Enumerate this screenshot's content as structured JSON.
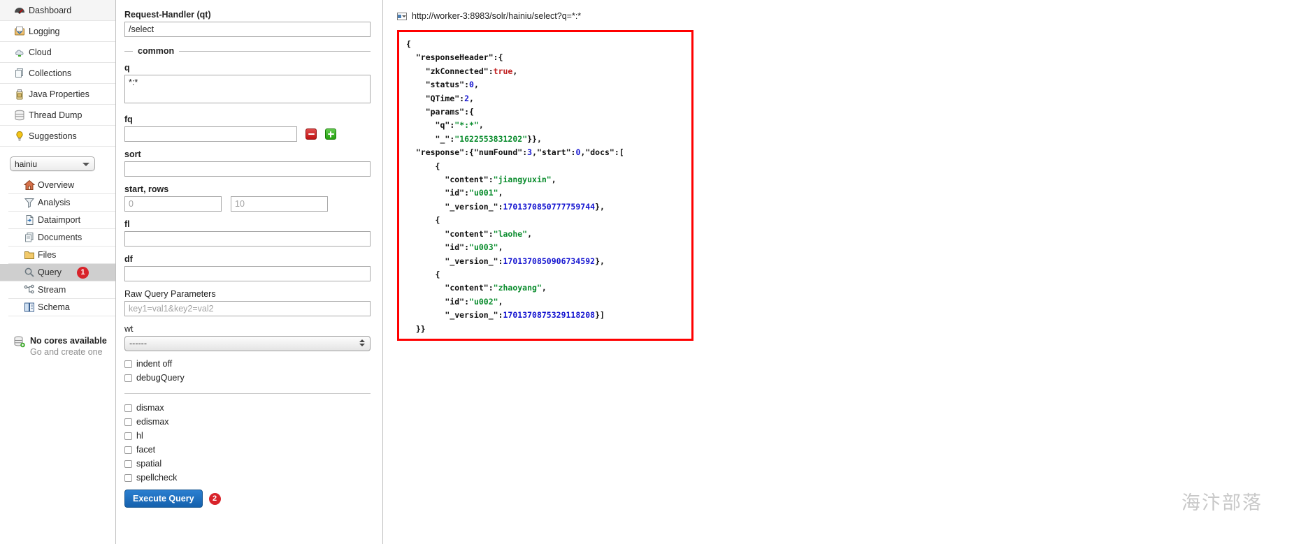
{
  "sidebar": {
    "main_items": [
      {
        "label": "Dashboard",
        "icon": "dashboard-icon"
      },
      {
        "label": "Logging",
        "icon": "logging-icon"
      },
      {
        "label": "Cloud",
        "icon": "cloud-icon"
      },
      {
        "label": "Collections",
        "icon": "collections-icon"
      },
      {
        "label": "Java Properties",
        "icon": "java-properties-icon"
      },
      {
        "label": "Thread Dump",
        "icon": "thread-dump-icon"
      },
      {
        "label": "Suggestions",
        "icon": "suggestions-icon"
      }
    ],
    "core_selector": {
      "value": "hainiu",
      "icon": "chevron-down-icon"
    },
    "core_items": [
      {
        "label": "Overview",
        "icon": "overview-home-icon",
        "active": false
      },
      {
        "label": "Analysis",
        "icon": "analysis-funnel-icon",
        "active": false
      },
      {
        "label": "Dataimport",
        "icon": "dataimport-icon",
        "active": false
      },
      {
        "label": "Documents",
        "icon": "documents-icon",
        "active": false
      },
      {
        "label": "Files",
        "icon": "files-folder-icon",
        "active": false
      },
      {
        "label": "Query",
        "icon": "query-magnifier-icon",
        "active": true,
        "badge": "1"
      },
      {
        "label": "Stream",
        "icon": "stream-graph-icon",
        "active": false
      },
      {
        "label": "Schema",
        "icon": "schema-book-icon",
        "active": false
      }
    ],
    "no_cores": {
      "title": "No cores available",
      "subtitle": "Go and create one",
      "icon": "core-add-icon"
    }
  },
  "query_form": {
    "request_handler": {
      "label": "Request-Handler (qt)",
      "value": "/select"
    },
    "common_legend": "common",
    "q": {
      "label": "q",
      "value": "*:*"
    },
    "fq": {
      "label": "fq",
      "value": "",
      "remove_icon": "minus-icon",
      "add_icon": "plus-icon"
    },
    "sort": {
      "label": "sort",
      "value": ""
    },
    "start_rows": {
      "label": "start, rows",
      "start_placeholder": "0",
      "rows_placeholder": "10",
      "start_value": "",
      "rows_value": ""
    },
    "fl": {
      "label": "fl",
      "value": ""
    },
    "df": {
      "label": "df",
      "value": ""
    },
    "raw_query_parameters": {
      "label": "Raw Query Parameters",
      "placeholder": "key1=val1&key2=val2",
      "value": ""
    },
    "wt": {
      "label": "wt",
      "selected": "------",
      "icon": "updown-arrows-icon"
    },
    "toggles_top": [
      {
        "label": "indent off",
        "checked": false
      },
      {
        "label": "debugQuery",
        "checked": false
      }
    ],
    "toggles_bottom": [
      {
        "label": "dismax",
        "checked": false
      },
      {
        "label": "edismax",
        "checked": false
      },
      {
        "label": "hl",
        "checked": false
      },
      {
        "label": "facet",
        "checked": false
      },
      {
        "label": "spatial",
        "checked": false
      },
      {
        "label": "spellcheck",
        "checked": false
      }
    ],
    "execute": {
      "label": "Execute Query",
      "badge": "2"
    }
  },
  "result": {
    "url": "http://worker-3:8983/solr/hainiu/select?q=*:*",
    "url_icon": "external-window-icon",
    "border_color": "#ff0000",
    "response_json": {
      "responseHeader": {
        "zkConnected": "true",
        "status": "0",
        "QTime": "2",
        "params": {
          "q": "*:*",
          "_": "1622553831202"
        }
      },
      "response": {
        "numFound": "3",
        "start": "0",
        "docs": [
          {
            "content": "jiangyuxin",
            "id": "u001",
            "_version_": "1701370850777759744"
          },
          {
            "content": "laohe",
            "id": "u003",
            "_version_": "1701370850906734592"
          },
          {
            "content": "zhaoyang",
            "id": "u002",
            "_version_": "1701370875329118208"
          }
        ]
      }
    }
  },
  "watermark": "海汴部落"
}
